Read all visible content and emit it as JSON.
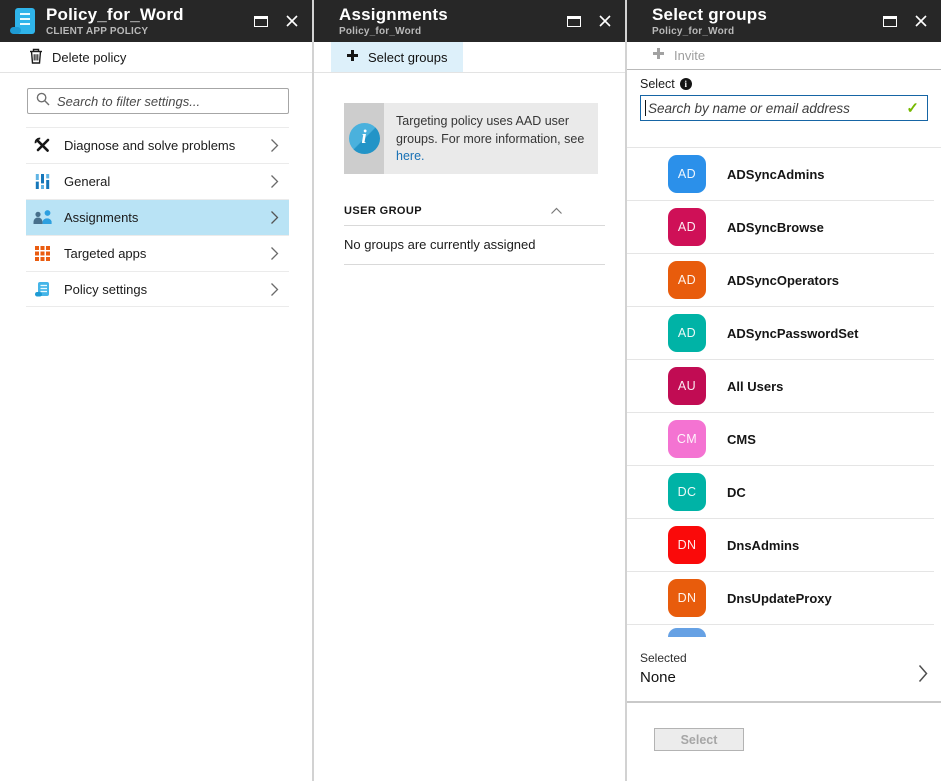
{
  "blade_policy": {
    "title": "Policy_for_Word",
    "subtitle": "CLIENT APP POLICY",
    "toolbar": {
      "delete_label": "Delete policy"
    },
    "search_placeholder": "Search to filter settings...",
    "menu": [
      {
        "label": "Diagnose and solve problems",
        "icon": "tools-icon",
        "selected": false
      },
      {
        "label": "General",
        "icon": "sliders-icon",
        "selected": false
      },
      {
        "label": "Assignments",
        "icon": "people-icon",
        "selected": true
      },
      {
        "label": "Targeted apps",
        "icon": "grid-icon",
        "selected": false
      },
      {
        "label": "Policy settings",
        "icon": "scroll-icon",
        "selected": false
      }
    ]
  },
  "blade_assignments": {
    "title": "Assignments",
    "subtitle": "Policy_for_Word",
    "toolbar": {
      "select_groups_label": "Select groups"
    },
    "info": {
      "text": "Targeting policy uses AAD user groups. For more information, see ",
      "link": "here."
    },
    "table": {
      "column_header": "USER GROUP",
      "empty_message": "No groups are currently assigned"
    }
  },
  "blade_select": {
    "title": "Select groups",
    "subtitle": "Policy_for_Word",
    "toolbar": {
      "invite_label": "Invite"
    },
    "select_label": "Select",
    "search_placeholder": "Search by name or email address",
    "groups": [
      {
        "initials": "AD",
        "name": "ADSyncAdmins",
        "color": "#2b90ea"
      },
      {
        "initials": "AD",
        "name": "ADSyncBrowse",
        "color": "#cf1057"
      },
      {
        "initials": "AD",
        "name": "ADSyncOperators",
        "color": "#e85c0c"
      },
      {
        "initials": "AD",
        "name": "ADSyncPasswordSet",
        "color": "#00b3a6"
      },
      {
        "initials": "AU",
        "name": "All Users",
        "color": "#c10c53"
      },
      {
        "initials": "CM",
        "name": "CMS",
        "color": "#f473d2"
      },
      {
        "initials": "DC",
        "name": "DC",
        "color": "#00b3a6"
      },
      {
        "initials": "DN",
        "name": "DnsAdmins",
        "color": "#fa0a0a"
      },
      {
        "initials": "DN",
        "name": "DnsUpdateProxy",
        "color": "#e85c0c"
      }
    ],
    "partial_group_color": "#66a1e4",
    "footer": {
      "selected_label": "Selected",
      "selected_value": "None",
      "select_button_label": "Select"
    }
  },
  "colors": {
    "header_bg": "#272727",
    "menu_selected_bg": "#b9e3f5",
    "toolbar_button_bg": "#ddf0fa",
    "search_focus_border": "#1665a5",
    "valid_check_green": "#76b900",
    "link_blue": "#1871b5"
  }
}
